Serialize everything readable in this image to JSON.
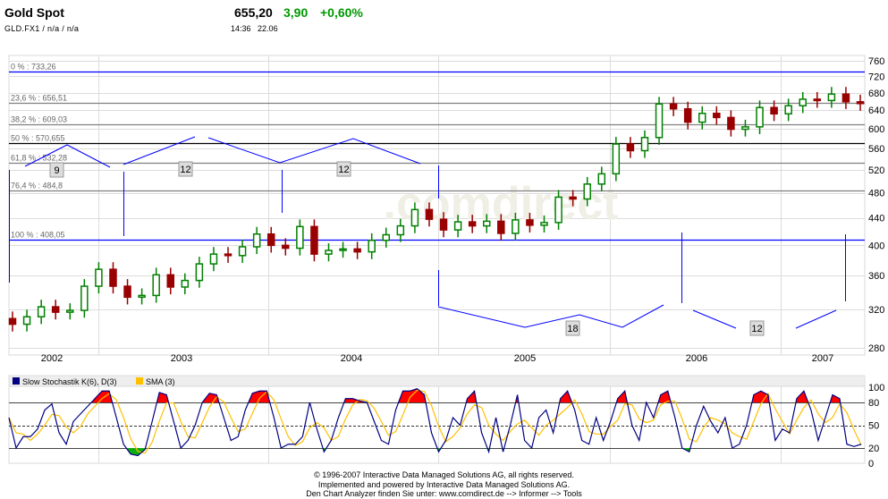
{
  "header": {
    "title": "Gold Spot",
    "symbol_line": "GLD.FX1  /  n/a  /  n/a",
    "price": "655,20",
    "change": "3,90",
    "change_pct": "+0,60%",
    "time": "14:36",
    "date": "22.06"
  },
  "watermark": ".comdirect",
  "chart_data": [
    {
      "type": "candlestick",
      "title": "Gold Spot",
      "scale": "log",
      "ylim": [
        280,
        760
      ],
      "y_ticks": [
        "760",
        "720",
        "680",
        "640",
        "600",
        "560",
        "520",
        "480",
        "440",
        "400",
        "360",
        "320",
        "280"
      ],
      "x_labels": [
        "2002",
        "2003",
        "2004",
        "2005",
        "2006",
        "2007"
      ],
      "period": "monthly 2002-07 to 2007-06",
      "first_open": 310,
      "closes": [
        304,
        312,
        323,
        317,
        319,
        347,
        368,
        347,
        334,
        336,
        361,
        346,
        354,
        375,
        388,
        386,
        398,
        416,
        400,
        396,
        427,
        388,
        393,
        395,
        391,
        407,
        415,
        428,
        453,
        438,
        422,
        434,
        428,
        435,
        417,
        437,
        429,
        433,
        473,
        470,
        495,
        513,
        569,
        556,
        582,
        654,
        643,
        614,
        633,
        624,
        599,
        604,
        646,
        632,
        650,
        665,
        662,
        677,
        659,
        655
      ],
      "fibonacci": [
        {
          "label": "0 % : 733,26",
          "value": 733.26,
          "color": "#0000ff"
        },
        {
          "label": "23,6 % : 656,51",
          "value": 656.51,
          "color": "#808080"
        },
        {
          "label": "38,2 % : 609,03",
          "value": 609.03,
          "color": "#808080"
        },
        {
          "label": "50 % : 570,655",
          "value": 570.655,
          "color": "#000000"
        },
        {
          "label": "61,8 % : 532,28",
          "value": 532.28,
          "color": "#808080"
        },
        {
          "label": "76,4 % : 484,8",
          "value": 484.8,
          "color": "#808080"
        },
        {
          "label": "100 % : 408,05",
          "value": 408.05,
          "color": "#0000ff"
        }
      ],
      "cycle_labels": [
        "9",
        "12",
        "12",
        "18",
        "12"
      ],
      "up_color": "#008000",
      "down_color": "#990000"
    },
    {
      "type": "line",
      "title": "Slow Stochastik K(6), D(3)",
      "legend": [
        {
          "name": "Slow Stochastik K(6), D(3)",
          "color": "#000080"
        },
        {
          "name": "SMA (3)",
          "color": "#ffc000"
        }
      ],
      "ylim": [
        0,
        100
      ],
      "y_ticks": [
        "100",
        "80",
        "50",
        "20",
        "0"
      ],
      "levels": [
        80,
        50,
        20
      ],
      "k_values": [
        60,
        20,
        35,
        35,
        45,
        70,
        78,
        40,
        25,
        55,
        65,
        75,
        85,
        95,
        95,
        60,
        25,
        12,
        10,
        18,
        55,
        93,
        90,
        55,
        20,
        30,
        50,
        80,
        92,
        90,
        60,
        30,
        35,
        70,
        92,
        95,
        95,
        60,
        20,
        25,
        25,
        35,
        80,
        45,
        15,
        30,
        60,
        85,
        85,
        82,
        80,
        55,
        30,
        25,
        70,
        95,
        95,
        98,
        90,
        40,
        15,
        30,
        60,
        50,
        85,
        95,
        40,
        15,
        60,
        15,
        50,
        90,
        30,
        20,
        60,
        70,
        40,
        85,
        95,
        70,
        30,
        25,
        60,
        30,
        55,
        85,
        95,
        50,
        30,
        80,
        60,
        90,
        95,
        60,
        20,
        15,
        50,
        75,
        55,
        40,
        60,
        20,
        25,
        50,
        90,
        95,
        90,
        30,
        45,
        40,
        85,
        95,
        70,
        30,
        60,
        90,
        85,
        25,
        22,
        25
      ]
    }
  ],
  "footer": [
    "© 1996-2007 Interactive Data Managed Solutions AG, all rights reserved.",
    "Implemented and powered by Interactive Data Managed Solutions AG.",
    "Den Chart Analyzer finden Sie unter: www.comdirect.de --> Informer --> Tools"
  ]
}
